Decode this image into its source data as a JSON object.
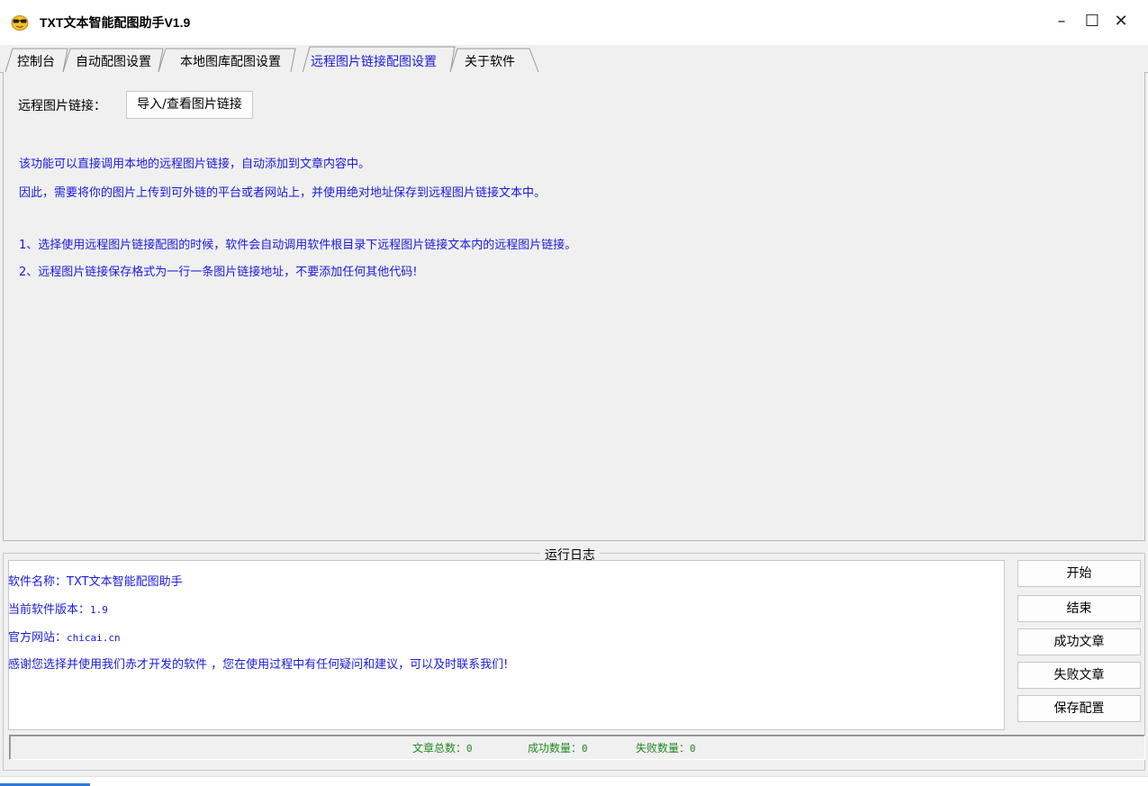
{
  "window": {
    "title": "TXT文本智能配图助手V1.9",
    "icon": "sunglasses-emoji-icon",
    "controls": {
      "minimize": "–",
      "maximize": "☐",
      "close": "✕"
    }
  },
  "tabs": [
    {
      "label": "控制台",
      "active": false
    },
    {
      "label": "自动配图设置",
      "active": false
    },
    {
      "label": "本地图库配图设置",
      "active": false
    },
    {
      "label": "远程图片链接配图设置",
      "active": true
    },
    {
      "label": "关于软件",
      "active": false
    }
  ],
  "remote": {
    "label": "远程图片链接：",
    "import_button": "导入/查看图片链接",
    "desc": [
      "该功能可以直接调用本地的远程图片链接，自动添加到文章内容中。",
      "因此，需要将你的图片上传到可外链的平台或者网站上，并使用绝对地址保存到远程图片链接文本中。",
      "1、选择使用远程图片链接配图的时候，软件会自动调用软件根目录下远程图片链接文本内的远程图片链接。",
      "2、远程图片链接保存格式为一行一条图片链接地址，不要添加任何其他代码!"
    ]
  },
  "log": {
    "title": "运行日志",
    "lines": [
      {
        "label": "软件名称：",
        "value": "TXT文本智能配图助手"
      },
      {
        "label": "当前软件版本：",
        "value": "1.9"
      },
      {
        "label": "官方网站：",
        "value": "chicai.cn"
      },
      {
        "label": "",
        "value": "感谢您选择并使用我们赤才开发的软件 ，您在使用过程中有任何疑问和建议，可以及时联系我们!"
      }
    ]
  },
  "buttons": {
    "start": "开始",
    "stop": "结束",
    "success_articles": "成功文章",
    "failed_articles": "失败文章",
    "save_config": "保存配置"
  },
  "stats": {
    "total_label": "文章总数：",
    "total": "0",
    "success_label": "成功数量：",
    "success": "0",
    "failed_label": "失败数量：",
    "failed": "0"
  },
  "colors": {
    "accent_text": "#1a1adc",
    "status_text": "#1f8a1f"
  }
}
